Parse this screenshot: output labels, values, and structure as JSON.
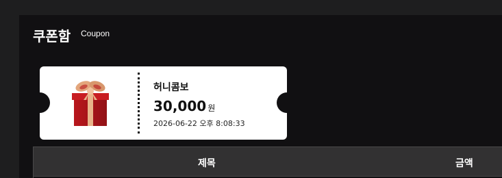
{
  "header": {
    "title": "쿠폰함",
    "subtitle": "Coupon"
  },
  "coupon": {
    "icon": "gift-box-icon",
    "name": "허니콤보",
    "amount": "30,000",
    "unit": "원",
    "datetime": "2026-06-22 오후 8:08:33",
    "colors": {
      "gift_box": "#b8161c",
      "ribbon": "#e8b48a"
    }
  },
  "table": {
    "columns": [
      "제목",
      "금액"
    ]
  },
  "colors": {
    "page_bg": "#1e1e1f",
    "panel_bg": "#111012",
    "coupon_bg": "#ffffff",
    "table_header_bg": "#323132"
  }
}
